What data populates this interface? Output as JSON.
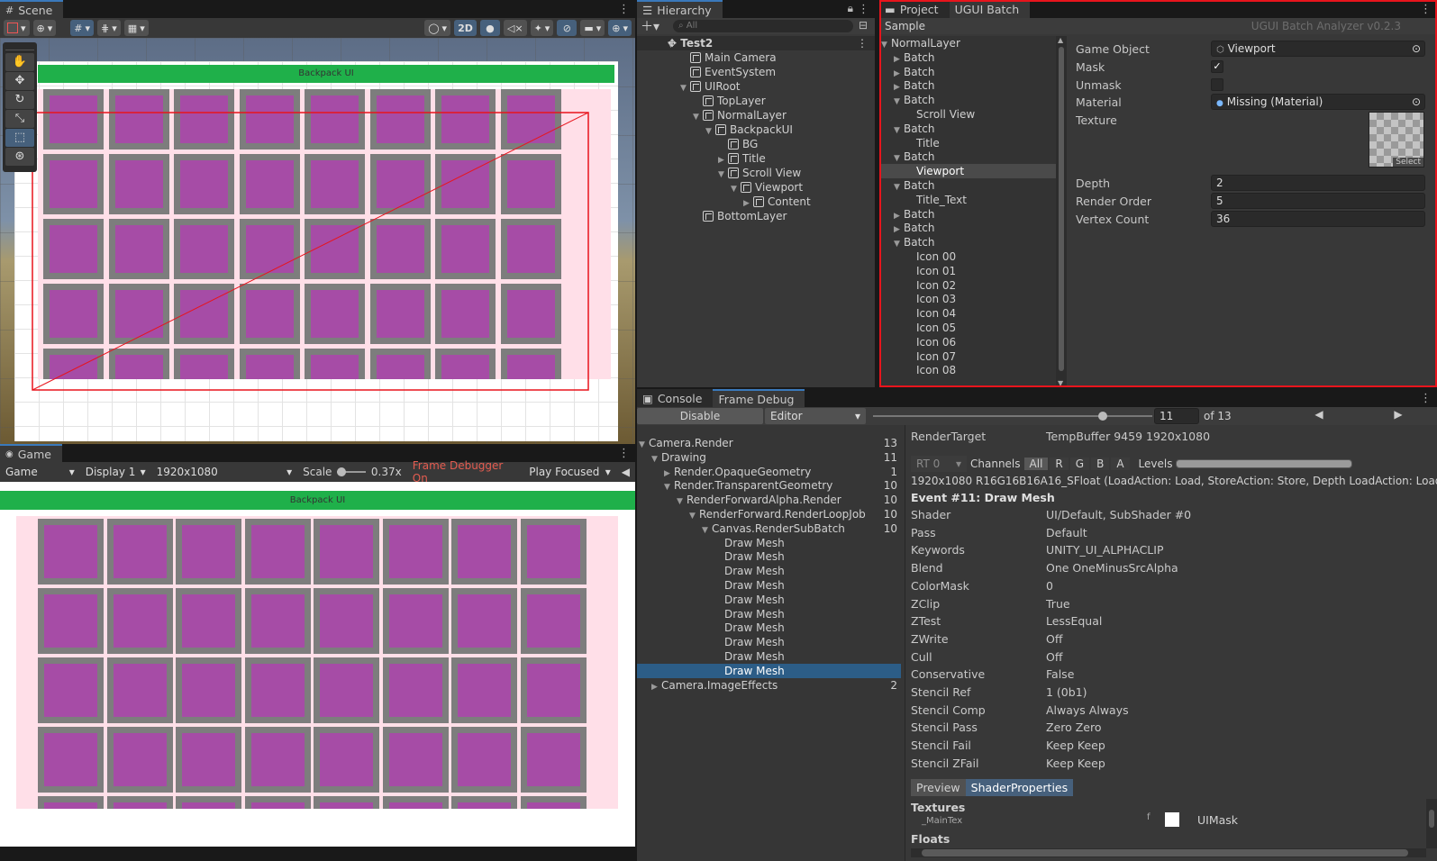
{
  "scene": {
    "tab": "Scene",
    "canvas_title": "Backpack UI",
    "tools": [
      "hand-icon",
      "move-icon",
      "rotate-icon",
      "scale-icon",
      "rect-tool-icon",
      "transform-icon"
    ],
    "btn_2d": "2D"
  },
  "game": {
    "tab": "Game",
    "mode": "Game",
    "display": "Display 1",
    "resolution": "1920x1080",
    "scale_label": "Scale",
    "scale_value": "0.37x",
    "frame_debugger": "Frame Debugger On",
    "play_focused": "Play Focused",
    "canvas_title": "Backpack UI"
  },
  "hierarchy": {
    "tab": "Hierarchy",
    "search_placeholder": "All",
    "root": "Test2",
    "items": [
      {
        "label": "Main Camera",
        "depth": 1,
        "arrow": ""
      },
      {
        "label": "EventSystem",
        "depth": 1,
        "arrow": ""
      },
      {
        "label": "UIRoot",
        "depth": 1,
        "arrow": "down"
      },
      {
        "label": "TopLayer",
        "depth": 2,
        "arrow": ""
      },
      {
        "label": "NormalLayer",
        "depth": 2,
        "arrow": "down"
      },
      {
        "label": "BackpackUI",
        "depth": 3,
        "arrow": "down"
      },
      {
        "label": "BG",
        "depth": 4,
        "arrow": ""
      },
      {
        "label": "Title",
        "depth": 4,
        "arrow": "right"
      },
      {
        "label": "Scroll View",
        "depth": 4,
        "arrow": "down"
      },
      {
        "label": "Viewport",
        "depth": 5,
        "arrow": "down"
      },
      {
        "label": "Content",
        "depth": 6,
        "arrow": "right"
      },
      {
        "label": "BottomLayer",
        "depth": 2,
        "arrow": ""
      }
    ]
  },
  "project_tab": "Project",
  "ugui": {
    "tab": "UGUI Batch",
    "sample": "Sample",
    "version": "UGUI Batch Analyzer v0.2.3",
    "tree": [
      {
        "label": "NormalLayer",
        "depth": 0,
        "arrow": "down"
      },
      {
        "label": "Batch",
        "depth": 1,
        "arrow": "right"
      },
      {
        "label": "Batch",
        "depth": 1,
        "arrow": "right"
      },
      {
        "label": "Batch",
        "depth": 1,
        "arrow": "right"
      },
      {
        "label": "Batch",
        "depth": 1,
        "arrow": "down"
      },
      {
        "label": "Scroll View",
        "depth": 2,
        "arrow": ""
      },
      {
        "label": "Batch",
        "depth": 1,
        "arrow": "down"
      },
      {
        "label": "Title",
        "depth": 2,
        "arrow": ""
      },
      {
        "label": "Batch",
        "depth": 1,
        "arrow": "down"
      },
      {
        "label": "Viewport",
        "depth": 2,
        "arrow": "",
        "selected": true
      },
      {
        "label": "Batch",
        "depth": 1,
        "arrow": "down"
      },
      {
        "label": "Title_Text",
        "depth": 2,
        "arrow": ""
      },
      {
        "label": "Batch",
        "depth": 1,
        "arrow": "right"
      },
      {
        "label": "Batch",
        "depth": 1,
        "arrow": "right"
      },
      {
        "label": "Batch",
        "depth": 1,
        "arrow": "down"
      },
      {
        "label": "Icon 00",
        "depth": 2,
        "arrow": ""
      },
      {
        "label": "Icon 01",
        "depth": 2,
        "arrow": ""
      },
      {
        "label": "Icon 02",
        "depth": 2,
        "arrow": ""
      },
      {
        "label": "Icon 03",
        "depth": 2,
        "arrow": ""
      },
      {
        "label": "Icon 04",
        "depth": 2,
        "arrow": ""
      },
      {
        "label": "Icon 05",
        "depth": 2,
        "arrow": ""
      },
      {
        "label": "Icon 06",
        "depth": 2,
        "arrow": ""
      },
      {
        "label": "Icon 07",
        "depth": 2,
        "arrow": ""
      },
      {
        "label": "Icon 08",
        "depth": 2,
        "arrow": ""
      }
    ],
    "props": {
      "game_object_label": "Game Object",
      "game_object": "Viewport",
      "mask_label": "Mask",
      "mask": true,
      "unmask_label": "Unmask",
      "unmask": false,
      "material_label": "Material",
      "material": "Missing (Material)",
      "texture_label": "Texture",
      "texture_select": "Select",
      "depth_label": "Depth",
      "depth": "2",
      "render_order_label": "Render Order",
      "render_order": "5",
      "vertex_count_label": "Vertex Count",
      "vertex_count": "36"
    }
  },
  "console_tab": "Console",
  "frame": {
    "tab": "Frame Debug",
    "disable": "Disable",
    "editor": "Editor",
    "event_index": "11",
    "of_total": "of 13",
    "tree": [
      {
        "label": "Camera.Render",
        "depth": 0,
        "arrow": "down",
        "count": "13"
      },
      {
        "label": "Drawing",
        "depth": 1,
        "arrow": "down",
        "count": "11"
      },
      {
        "label": "Render.OpaqueGeometry",
        "depth": 2,
        "arrow": "right",
        "count": "1"
      },
      {
        "label": "Render.TransparentGeometry",
        "depth": 2,
        "arrow": "down",
        "count": "10"
      },
      {
        "label": "RenderForwardAlpha.Render",
        "depth": 3,
        "arrow": "down",
        "count": "10"
      },
      {
        "label": "RenderForward.RenderLoopJob",
        "depth": 4,
        "arrow": "down",
        "count": "10"
      },
      {
        "label": "Canvas.RenderSubBatch",
        "depth": 5,
        "arrow": "down",
        "count": "10"
      },
      {
        "label": "Draw Mesh",
        "depth": 6,
        "arrow": "",
        "count": ""
      },
      {
        "label": "Draw Mesh",
        "depth": 6,
        "arrow": "",
        "count": ""
      },
      {
        "label": "Draw Mesh",
        "depth": 6,
        "arrow": "",
        "count": ""
      },
      {
        "label": "Draw Mesh",
        "depth": 6,
        "arrow": "",
        "count": ""
      },
      {
        "label": "Draw Mesh",
        "depth": 6,
        "arrow": "",
        "count": ""
      },
      {
        "label": "Draw Mesh",
        "depth": 6,
        "arrow": "",
        "count": ""
      },
      {
        "label": "Draw Mesh",
        "depth": 6,
        "arrow": "",
        "count": ""
      },
      {
        "label": "Draw Mesh",
        "depth": 6,
        "arrow": "",
        "count": ""
      },
      {
        "label": "Draw Mesh",
        "depth": 6,
        "arrow": "",
        "count": ""
      },
      {
        "label": "Draw Mesh",
        "depth": 6,
        "arrow": "",
        "count": "",
        "selected": true
      },
      {
        "label": "Camera.ImageEffects",
        "depth": 1,
        "arrow": "right",
        "count": "2"
      }
    ],
    "render_target_label": "RenderTarget",
    "render_target": "TempBuffer 9459 1920x1080",
    "rt": "RT 0",
    "channels_label": "Channels",
    "channels": [
      "All",
      "R",
      "G",
      "B",
      "A"
    ],
    "levels_label": "Levels",
    "format_line": "1920x1080 R16G16B16A16_SFloat (LoadAction: Load, StoreAction: Store, Depth LoadAction: Load, Dep",
    "event_title": "Event #11: Draw Mesh",
    "details": [
      {
        "k": "Shader",
        "v": "UI/Default, SubShader #0"
      },
      {
        "k": "Pass",
        "v": "Default"
      },
      {
        "k": "Keywords",
        "v": "UNITY_UI_ALPHACLIP"
      },
      {
        "k": "Blend",
        "v": "One OneMinusSrcAlpha"
      },
      {
        "k": "ColorMask",
        "v": "0"
      },
      {
        "k": "ZClip",
        "v": "True"
      },
      {
        "k": "ZTest",
        "v": "LessEqual"
      },
      {
        "k": "ZWrite",
        "v": "Off"
      },
      {
        "k": "Cull",
        "v": "Off"
      },
      {
        "k": "Conservative",
        "v": "False"
      },
      {
        "k": "Stencil Ref",
        "v": "1 (0b1)"
      },
      {
        "k": "Stencil Comp",
        "v": "Always Always"
      },
      {
        "k": "Stencil Pass",
        "v": "Zero Zero"
      },
      {
        "k": "Stencil Fail",
        "v": "Keep Keep"
      },
      {
        "k": "Stencil ZFail",
        "v": "Keep Keep"
      }
    ],
    "preview_tab": "Preview",
    "shader_props_tab": "ShaderProperties",
    "textures_label": "Textures",
    "maintex_label": "_MainTex",
    "maintex_flag": "f",
    "maintex_value": "UIMask",
    "floats_label": "Floats"
  },
  "colors": {
    "accent": "#3a79bb",
    "selection": "#2c5d87",
    "highlight_border": "#e8141c",
    "green_bar": "#1fb04a",
    "purple": "#a64ca6",
    "pink": "#ffdfe8"
  }
}
